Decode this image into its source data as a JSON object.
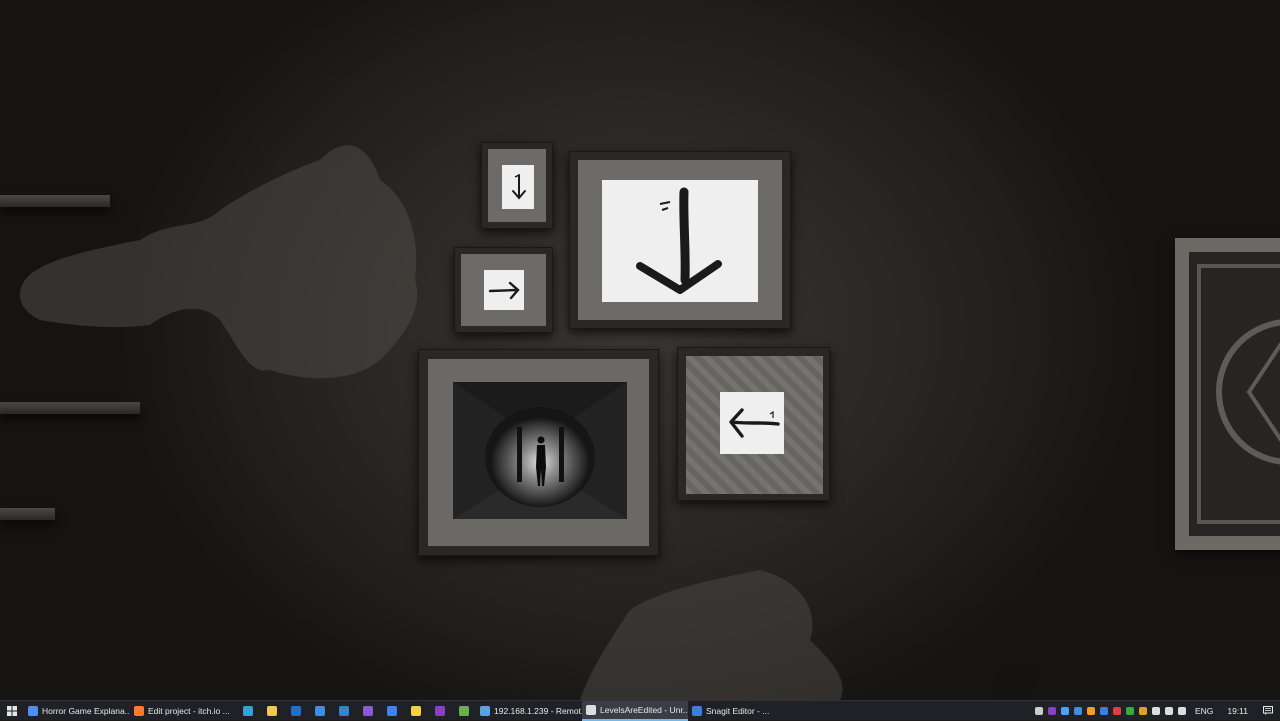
{
  "taskbar": {
    "apps": [
      {
        "label": "Horror Game Explana...",
        "icon": "chrome-icon",
        "color": "#4f8ef2"
      },
      {
        "label": "Edit project - itch.io ...",
        "icon": "firefox-icon",
        "color": "#ff7a2a"
      }
    ],
    "pinned": [
      {
        "icon": "edge-icon",
        "color": "#2fa4d8"
      },
      {
        "icon": "file-explorer-icon",
        "color": "#f2c94c"
      },
      {
        "icon": "outlook-icon",
        "color": "#1f6fd1"
      },
      {
        "icon": "mail-icon",
        "color": "#3d8fe0"
      },
      {
        "icon": "sourcetree-icon",
        "color": "#2d87c9"
      },
      {
        "icon": "visual-studio-icon",
        "color": "#8b5bd6"
      },
      {
        "icon": "todo-icon",
        "color": "#3b82f6"
      },
      {
        "icon": "sticky-notes-icon",
        "color": "#f5d13b"
      },
      {
        "icon": "onenote-icon",
        "color": "#8a3fc8"
      },
      {
        "icon": "terminal-icon",
        "color": "#6ab04c"
      }
    ],
    "apps2": [
      {
        "label": "192.168.1.239 - Remot...",
        "icon": "remote-desktop-icon",
        "color": "#5aa0e6"
      },
      {
        "label": "LevelsAreEdited - Unr...",
        "icon": "unreal-engine-icon",
        "color": "#dddddd",
        "active": true
      },
      {
        "label": "Snagit Editor - ...",
        "icon": "snagit-icon",
        "color": "#3d7ee0"
      }
    ],
    "tray_icons": [
      {
        "icon": "chevron-up-icon",
        "color": "#cccccc"
      },
      {
        "icon": "onenote-tray-icon",
        "color": "#8a3fc8"
      },
      {
        "icon": "cloud-tray-icon",
        "color": "#4aa3ff"
      },
      {
        "icon": "defender-icon",
        "color": "#3d8fe0"
      },
      {
        "icon": "search-tray-icon",
        "color": "#f0a020"
      },
      {
        "icon": "app-tray-icon",
        "color": "#3d7ee0"
      },
      {
        "icon": "paint-tray-icon",
        "color": "#e04040"
      },
      {
        "icon": "xbox-tray-icon",
        "color": "#30b040"
      },
      {
        "icon": "sync-tray-icon",
        "color": "#e0a020"
      },
      {
        "icon": "onedrive-icon",
        "color": "#dddddd"
      },
      {
        "icon": "network-icon",
        "color": "#dddddd"
      },
      {
        "icon": "volume-icon",
        "color": "#dddddd"
      }
    ],
    "language": "ENG",
    "time": "19:11"
  }
}
